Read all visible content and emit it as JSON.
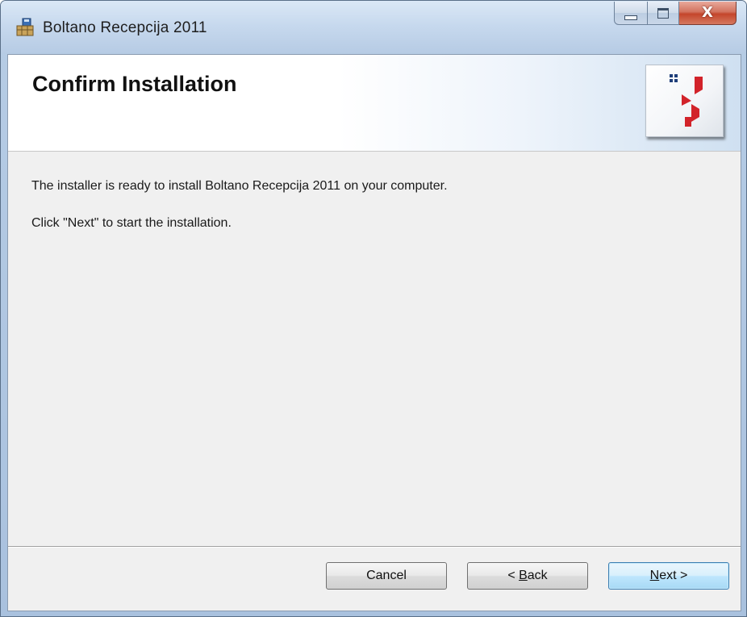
{
  "window": {
    "title": "Boltano  Recepcija 2011",
    "close_glyph": "X"
  },
  "banner": {
    "title": "Confirm Installation",
    "logo_icon": "boltano-logo-icon"
  },
  "content": {
    "line1": "The installer is ready to install Boltano  Recepcija 2011 on your computer.",
    "line2": "Click \"Next\" to start the installation."
  },
  "buttons": {
    "cancel": "Cancel",
    "back_prefix": "< ",
    "back_mnemonic": "B",
    "back_rest": "ack",
    "next_mnemonic": "N",
    "next_rest": "ext >"
  },
  "colors": {
    "logo_red": "#d2232a",
    "logo_dots": "#1f3f7a",
    "default_button_border": "#3c7fb1"
  }
}
